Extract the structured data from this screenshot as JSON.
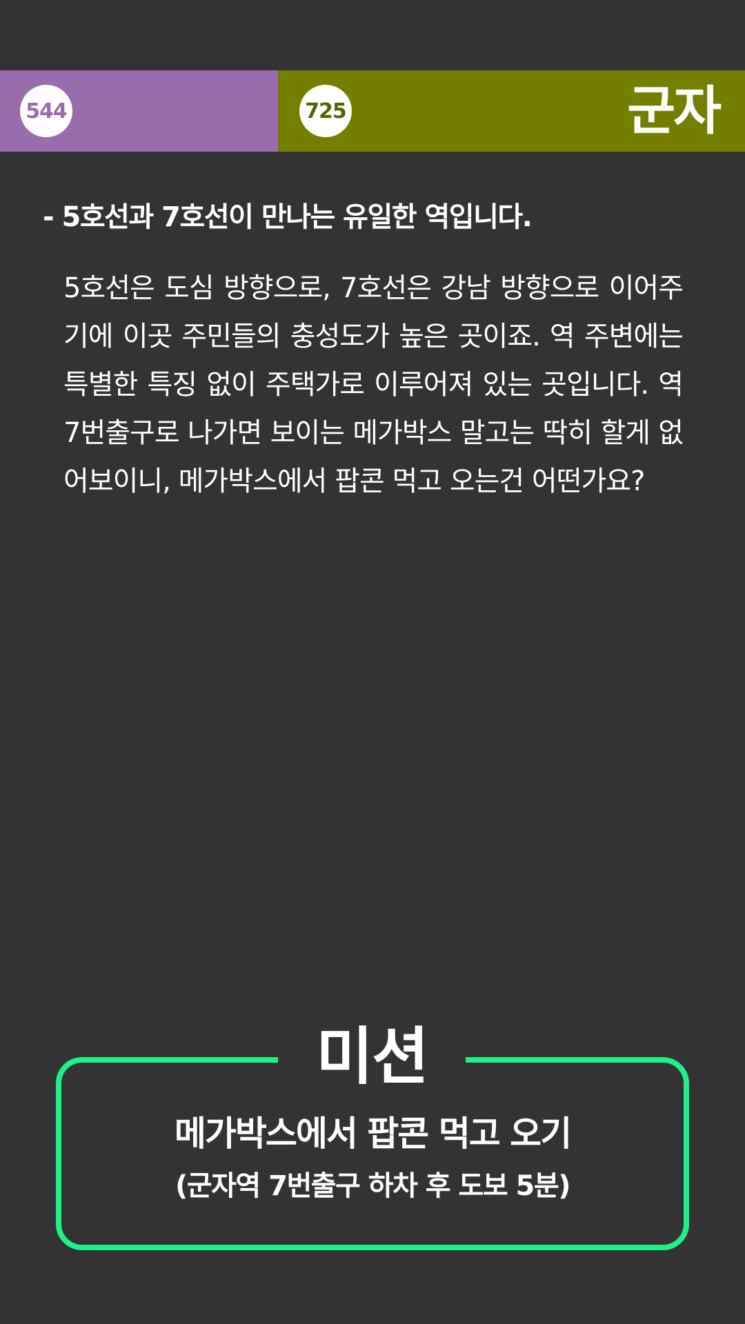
{
  "header": {
    "line5": {
      "number": "544",
      "color": "#996cac"
    },
    "line7": {
      "number": "725",
      "color": "#747f00"
    },
    "station_name": "군자"
  },
  "content": {
    "headline": "- 5호선과 7호선이 만나는 유일한 역입니다.",
    "description": "5호선은 도심 방향으로, 7호선은 강남 방향으로 이어주기에 이곳 주민들의 충성도가 높은 곳이죠. 역 주변에는 특별한 특징 없이 주택가로 이루어져 있는 곳입니다. 역 7번출구로 나가면 보이는 메가박스 말고는 딱히 할게 없어보이니, 메가박스에서 팝콘 먹고 오는건 어떤가요?"
  },
  "mission": {
    "title": "미션",
    "task": "메가박스에서 팝콘 먹고 오기",
    "detail": "(군자역 7번출구 하차 후 도보 5분)",
    "accent_color": "#1ef08a"
  },
  "background_color": "#333333"
}
